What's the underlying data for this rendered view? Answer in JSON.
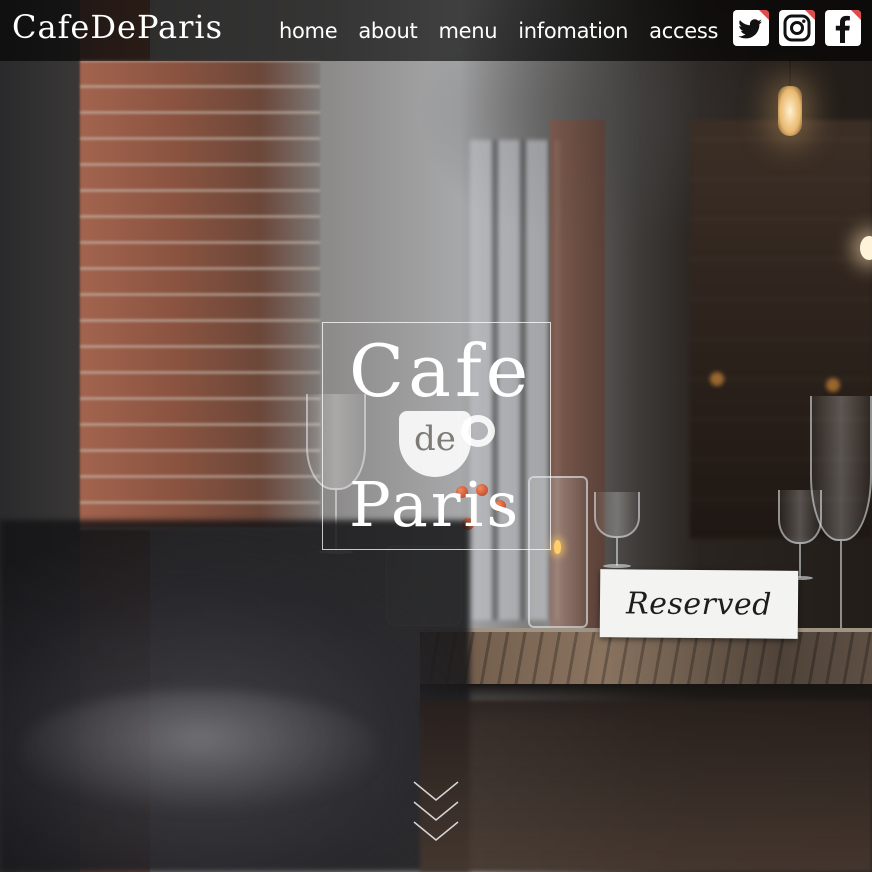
{
  "header": {
    "logo_text": "CafeDeParis",
    "nav": [
      {
        "label": "home"
      },
      {
        "label": "about"
      },
      {
        "label": "menu"
      },
      {
        "label": "infomation"
      },
      {
        "label": "access"
      }
    ],
    "social": [
      {
        "name": "twitter-icon"
      },
      {
        "name": "instagram-icon"
      },
      {
        "name": "facebook-icon"
      }
    ],
    "social_accent_color": "#e04b4b"
  },
  "hero": {
    "emblem": {
      "line1": "Cafe",
      "line2": "de",
      "line3": "Paris"
    },
    "sign_text": "Reserved",
    "scroll_icon": "chevrons-down-icon"
  }
}
